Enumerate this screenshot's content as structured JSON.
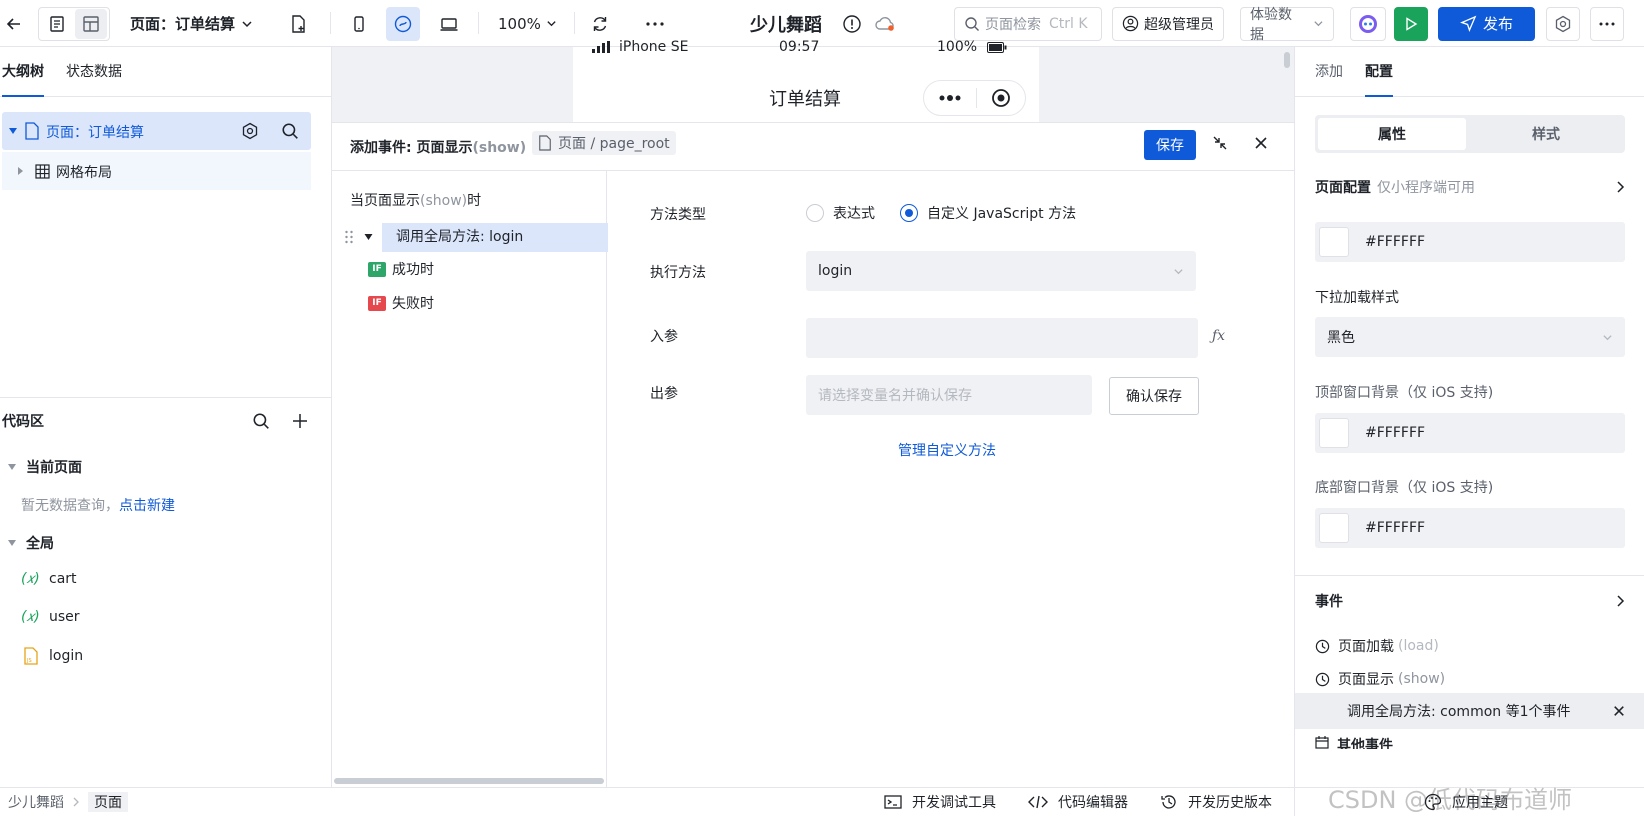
{
  "topbar": {
    "page_label": "页面：订单结算",
    "zoom": "100%",
    "app_title": "少儿舞蹈",
    "search_placeholder": "页面检索",
    "search_shortcut": "Ctrl K",
    "admin_label": "超级管理员",
    "data_label": "体验数据",
    "publish_label": "发布"
  },
  "left": {
    "tabs": [
      "大纲树",
      "状态数据"
    ],
    "tree": {
      "page": "页面：订单结算",
      "child": "网格布局"
    },
    "code_section": {
      "title": "代码区",
      "current_page": "当前页面",
      "empty_text": "暂无数据查询，",
      "create_link": "点击新建",
      "global": "全局",
      "items": [
        "cart",
        "user",
        "login"
      ]
    }
  },
  "canvas": {
    "phone_model": "iPhone SE",
    "time": "09:57",
    "battery": "100%",
    "page_title": "订单结算"
  },
  "event_panel": {
    "header_prefix": "添加事件: 页面显示",
    "header_event": "(show)",
    "target": "页面 / page_root",
    "save_label": "保存",
    "trigger_prefix": "当页面显示",
    "trigger_event": "(show)",
    "trigger_suffix": "时",
    "action": "调用全局方法: login",
    "branches": [
      {
        "tag": "IF",
        "label": "成功时",
        "color": "#2ea66a"
      },
      {
        "tag": "IF",
        "label": "失败时",
        "color": "#e5484d"
      }
    ],
    "form": {
      "method_type_label": "方法类型",
      "option_expression": "表达式",
      "option_custom": "自定义 JavaScript 方法",
      "exec_label": "执行方法",
      "exec_value": "login",
      "input_label": "入参",
      "output_label": "出参",
      "output_placeholder": "请选择变量名并确认保存",
      "confirm_label": "确认保存",
      "manage_link": "管理自定义方法"
    }
  },
  "right": {
    "tabs": [
      "添加",
      "配置"
    ],
    "segments": [
      "属性",
      "样式"
    ],
    "page_config_title": "页面配置",
    "page_config_note": "仅小程序端可用",
    "bg_color": "#FFFFFF",
    "pulldown_label": "下拉加载样式",
    "pulldown_value": "黑色",
    "top_bg_label": "顶部窗口背景（仅 iOS 支持)",
    "top_bg_value": "#FFFFFF",
    "bottom_bg_label": "底部窗口背景（仅 iOS 支持)",
    "bottom_bg_value": "#FFFFFF",
    "events_title": "事件",
    "event_load": "页面加载",
    "event_load_tag": "(load)",
    "event_show": "页面显示",
    "event_show_tag": "(show)",
    "event_highlight": "调用全局方法: common 等1个事件",
    "event_other": "其他事件"
  },
  "bottom": {
    "breadcrumb": [
      "少儿舞蹈",
      "页面"
    ],
    "debug_tool": "开发调试工具",
    "code_editor": "代码编辑器",
    "history": "开发历史版本",
    "theme": "应用主题",
    "watermark": "CSDN @低代码布道师"
  },
  "colors": {
    "primary": "#0f5ad8",
    "selected_bg": "#dbe6fb",
    "run_green": "#1aa35a"
  }
}
